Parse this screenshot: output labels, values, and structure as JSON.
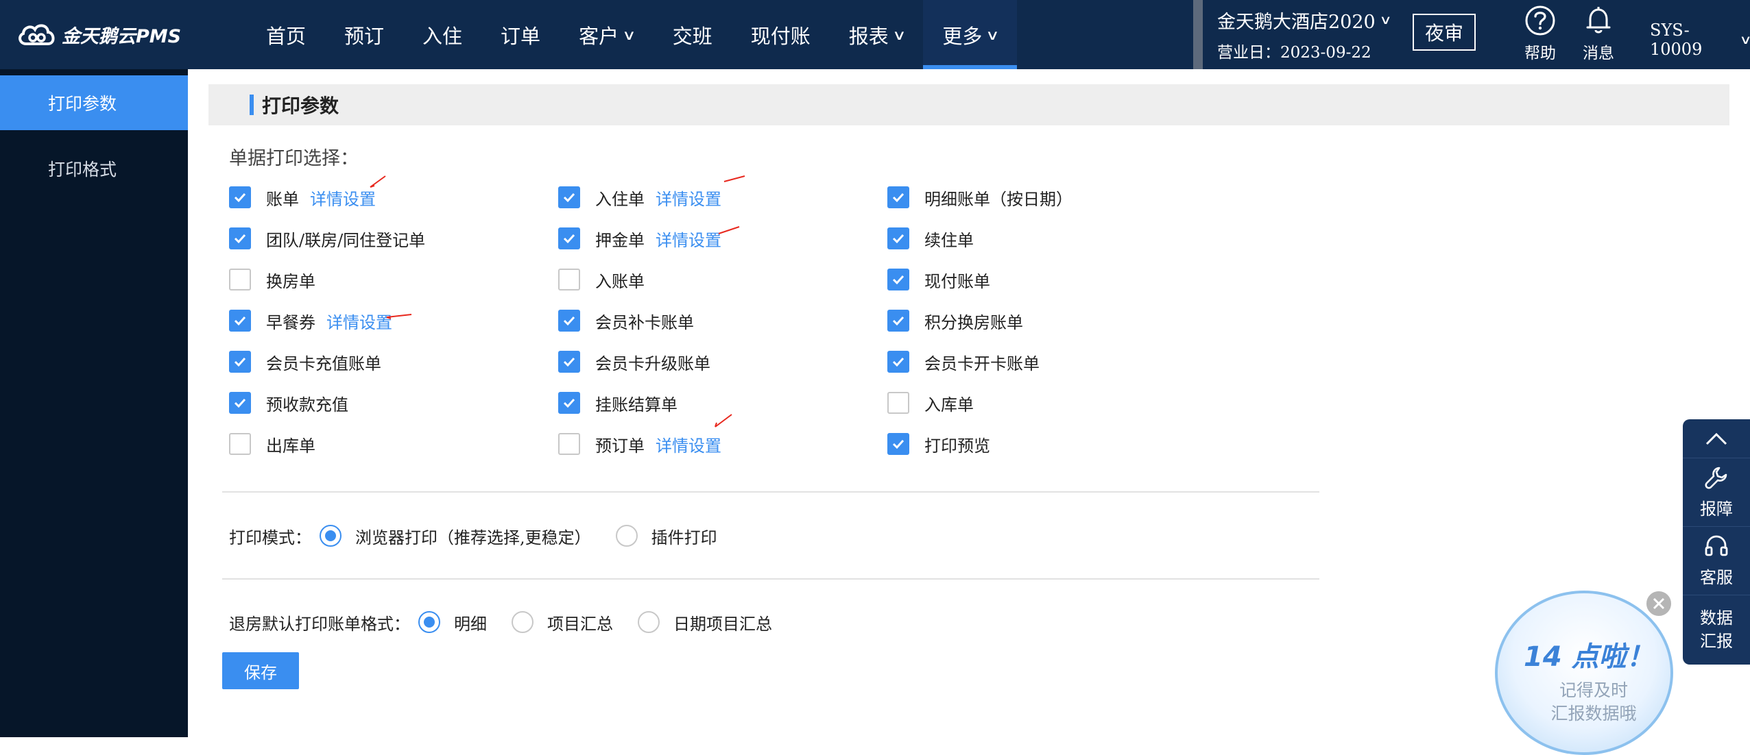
{
  "brand": {
    "logo_text": "金天鹅云PMS"
  },
  "nav": {
    "items": [
      {
        "label": "首页",
        "has_dropdown": false
      },
      {
        "label": "预订",
        "has_dropdown": false
      },
      {
        "label": "入住",
        "has_dropdown": false
      },
      {
        "label": "订单",
        "has_dropdown": false
      },
      {
        "label": "客户",
        "has_dropdown": true
      },
      {
        "label": "交班",
        "has_dropdown": false
      },
      {
        "label": "现付账",
        "has_dropdown": false
      },
      {
        "label": "报表",
        "has_dropdown": true
      },
      {
        "label": "更多",
        "has_dropdown": true,
        "active": true
      }
    ]
  },
  "hotel": {
    "name": "金天鹅大酒店2020",
    "business_date": "营业日：2023-09-22"
  },
  "header_actions": {
    "night_audit": "夜审",
    "help": "帮助",
    "messages": "消息",
    "user": "SYS-10009"
  },
  "sidebar": {
    "items": [
      {
        "label": "打印参数",
        "active": true
      },
      {
        "label": "打印格式",
        "active": false
      }
    ]
  },
  "section": {
    "title": "打印参数",
    "group_label": "单据打印选择："
  },
  "print_options": [
    {
      "label": "账单",
      "checked": true,
      "detail": "详情设置"
    },
    {
      "label": "入住单",
      "checked": true,
      "detail": "详情设置"
    },
    {
      "label": "明细账单（按日期）",
      "checked": true
    },
    {
      "label": "团队/联房/同住登记单",
      "checked": true
    },
    {
      "label": "押金单",
      "checked": true,
      "detail": "详情设置"
    },
    {
      "label": "续住单",
      "checked": true
    },
    {
      "label": "换房单",
      "checked": false
    },
    {
      "label": "入账单",
      "checked": false
    },
    {
      "label": "现付账单",
      "checked": true
    },
    {
      "label": "早餐券",
      "checked": true,
      "detail": "详情设置"
    },
    {
      "label": "会员补卡账单",
      "checked": true
    },
    {
      "label": "积分换房账单",
      "checked": true
    },
    {
      "label": "会员卡充值账单",
      "checked": true
    },
    {
      "label": "会员卡升级账单",
      "checked": true
    },
    {
      "label": "会员卡开卡账单",
      "checked": true
    },
    {
      "label": "预收款充值",
      "checked": true
    },
    {
      "label": "挂账结算单",
      "checked": true
    },
    {
      "label": "入库单",
      "checked": false
    },
    {
      "label": "出库单",
      "checked": false
    },
    {
      "label": "预订单",
      "checked": false,
      "detail": "详情设置"
    },
    {
      "label": "打印预览",
      "checked": true
    }
  ],
  "print_mode": {
    "label": "打印模式：",
    "options": [
      {
        "label": "浏览器打印（推荐选择,更稳定）",
        "selected": true
      },
      {
        "label": "插件打印",
        "selected": false
      }
    ]
  },
  "checkout_format": {
    "label": "退房默认打印账单格式：",
    "options": [
      {
        "label": "明细",
        "selected": true
      },
      {
        "label": "项目汇总",
        "selected": false
      },
      {
        "label": "日期项目汇总",
        "selected": false
      }
    ]
  },
  "save_label": "保存",
  "float_panel": {
    "report": "报障",
    "service": "客服",
    "data_line1": "数据",
    "data_line2": "汇报"
  },
  "reminder": {
    "headline": "14 点啦！",
    "line1": "记得及时",
    "line2": "汇报数据哦"
  },
  "colors": {
    "topbar": "#0f2a4d",
    "sidebar": "#061629",
    "accent": "#3a8ef0",
    "annotation": "#e8281e"
  }
}
